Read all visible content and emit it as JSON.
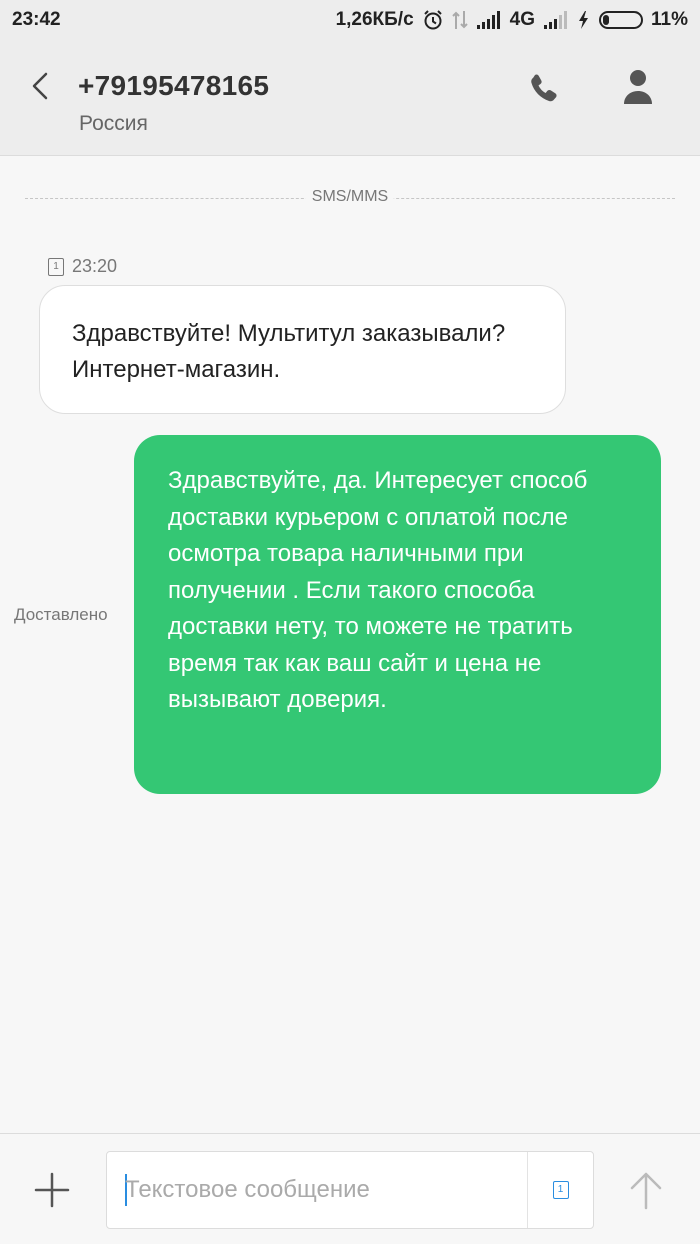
{
  "status_bar": {
    "time": "23:42",
    "net_speed": "1,26КБ/с",
    "network_type": "4G",
    "battery": "11%",
    "battery_level": 0.11,
    "icons": [
      "alarm-icon",
      "data-arrows-icon",
      "signal-icon",
      "charging-icon",
      "battery-icon"
    ]
  },
  "header": {
    "contact_number": "+79195478165",
    "contact_country": "Россия",
    "icons": [
      "back-icon",
      "phone-icon",
      "person-icon"
    ]
  },
  "conversation": {
    "channel_label": "SMS/MMS",
    "messages": [
      {
        "direction": "incoming",
        "sim": "1",
        "time": "23:20",
        "text": "Здравствуйте! Мультитул заказывали? Интернет-магазин."
      },
      {
        "direction": "outgoing",
        "status": "Доставлено",
        "text": "Здравствуйте, да. Интересует способ доставки курьером с оплатой после осмотра товара наличными при получении . Если такого способа доставки нету, то можете не тратить время так как ваш сайт и цена не вызывают доверия."
      }
    ]
  },
  "composer": {
    "placeholder": "Текстовое сообщение",
    "value": "",
    "sim": "1",
    "icons": [
      "add-icon",
      "sim-icon",
      "send-arrow-icon"
    ]
  },
  "colors": {
    "outgoing_bubble": "#34c774",
    "incoming_bubble": "#ffffff",
    "accent": "#2a8de0",
    "header_bg": "#ededed"
  }
}
